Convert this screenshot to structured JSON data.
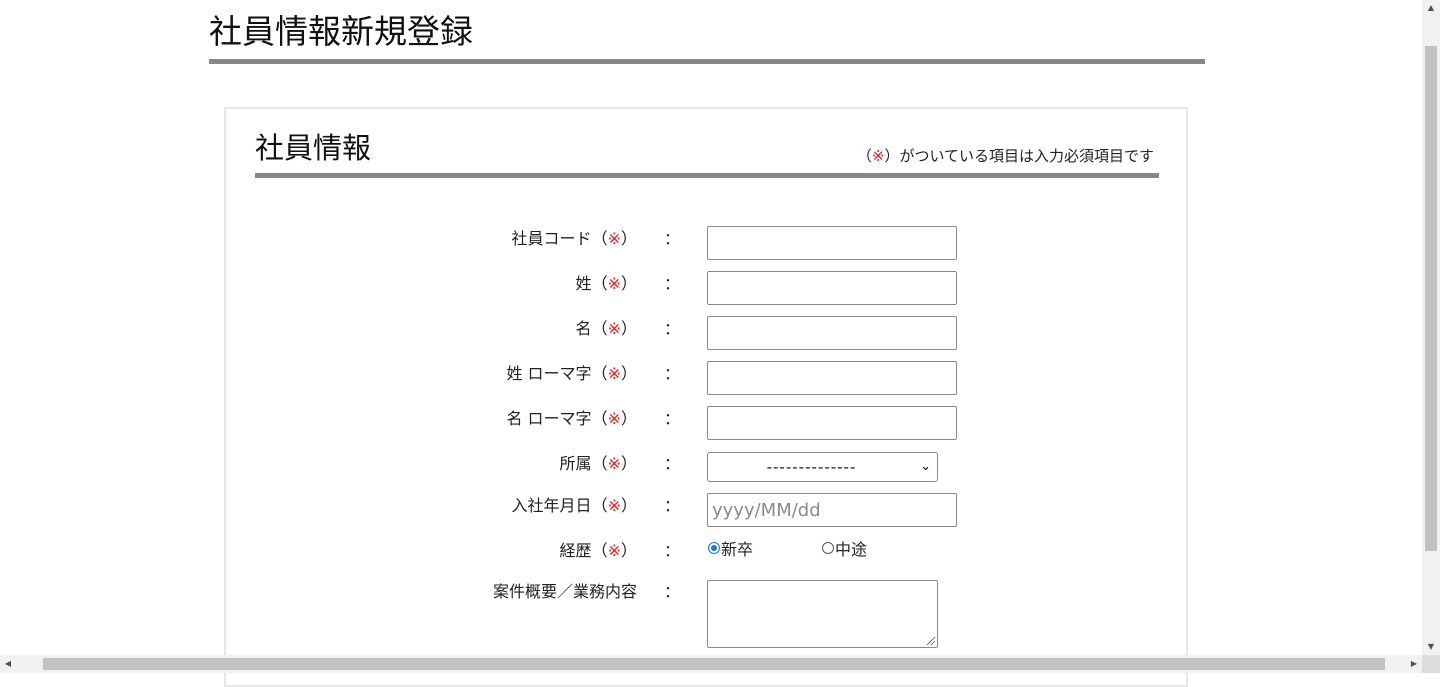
{
  "page": {
    "title": "社員情報新規登録"
  },
  "section": {
    "title": "社員情報",
    "note_open": "（",
    "note_mark": "※",
    "note_rest": "）がついている項目は入力必須項目です"
  },
  "form": {
    "colon": "：",
    "required_open": "（",
    "required_mark": "※",
    "required_close": "）",
    "employee_code": {
      "label": "社員コード",
      "value": ""
    },
    "last_name": {
      "label": "姓",
      "value": ""
    },
    "first_name": {
      "label": "名",
      "value": ""
    },
    "last_name_roman": {
      "label": "姓 ローマ字",
      "value": ""
    },
    "first_name_roman": {
      "label": "名 ローマ字",
      "value": ""
    },
    "department": {
      "label": "所属",
      "selected": "--------------"
    },
    "hire_date": {
      "label": "入社年月日",
      "value": "",
      "placeholder": "yyyy/MM/dd"
    },
    "career": {
      "label": "経歴",
      "options": [
        {
          "label": "新卒",
          "checked": true
        },
        {
          "label": "中途",
          "checked": false
        }
      ]
    },
    "project_summary": {
      "label": "案件概要／業務内容",
      "value": ""
    }
  },
  "icons": {
    "select_arrow": "chevron-down-icon",
    "scroll_up": "triangle-up-icon",
    "scroll_down": "triangle-down-icon",
    "scroll_left": "triangle-left-icon",
    "scroll_right": "triangle-right-icon"
  },
  "colors": {
    "required_mark": "#e02020",
    "rule": "#888888",
    "radio_checked": "#1a73e8"
  }
}
